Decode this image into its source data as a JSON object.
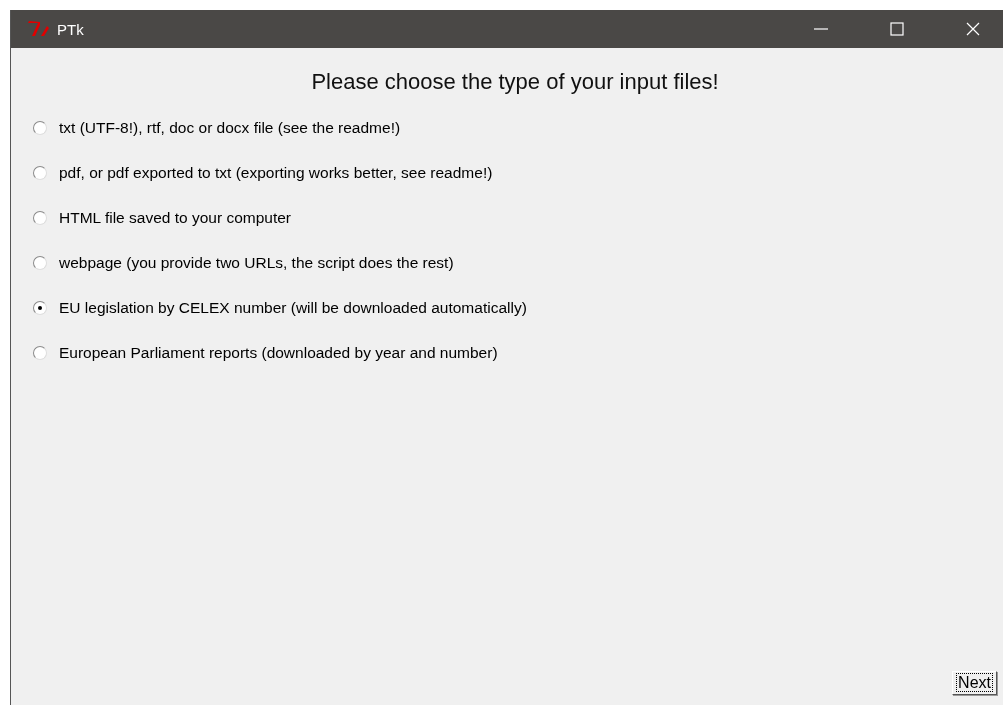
{
  "window": {
    "title": "PTk"
  },
  "heading": "Please choose the type of your input files!",
  "options": [
    {
      "label": "txt (UTF-8!), rtf, doc or docx file (see the readme!)",
      "selected": false
    },
    {
      "label": "pdf, or pdf exported to txt (exporting works better, see readme!)",
      "selected": false
    },
    {
      "label": "HTML file saved to your computer",
      "selected": false
    },
    {
      "label": "webpage (you provide two URLs, the script does the rest)",
      "selected": false
    },
    {
      "label": "EU legislation by CELEX number (will be downloaded automatically)",
      "selected": true
    },
    {
      "label": "European Parliament reports (downloaded by year and number)",
      "selected": false
    }
  ],
  "buttons": [
    "Next"
  ]
}
